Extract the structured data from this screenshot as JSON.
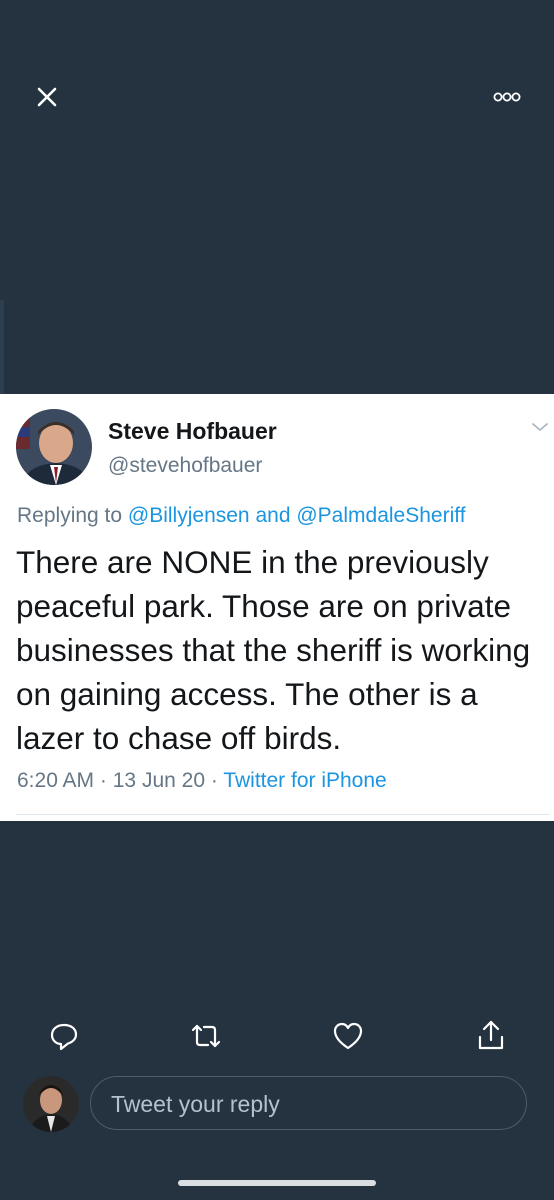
{
  "nav": {
    "close_icon": "close-icon",
    "more_icon": "more-icon"
  },
  "tweet": {
    "author_name": "Steve Hofbauer",
    "author_handle": "@stevehofbauer",
    "replying_prefix": "Replying to",
    "reply_to_1": "@Billyjensen",
    "reply_joiner": "and",
    "reply_to_2": "@PalmdaleSheriff",
    "text": "There are NONE in the previously peaceful park. Those are on private businesses that the sheriff is working on gaining access. The other is a lazer to chase off birds.",
    "time": "6:20 AM",
    "date": "13 Jun 20",
    "separator": "·",
    "source": "Twitter for iPhone"
  },
  "actions": [
    "reply-icon",
    "retweet-icon",
    "like-icon",
    "share-icon"
  ],
  "reply_input": {
    "placeholder": "Tweet your reply"
  },
  "colors": {
    "background": "#253341",
    "link": "#1b95e0",
    "secondary_text": "#657786"
  }
}
